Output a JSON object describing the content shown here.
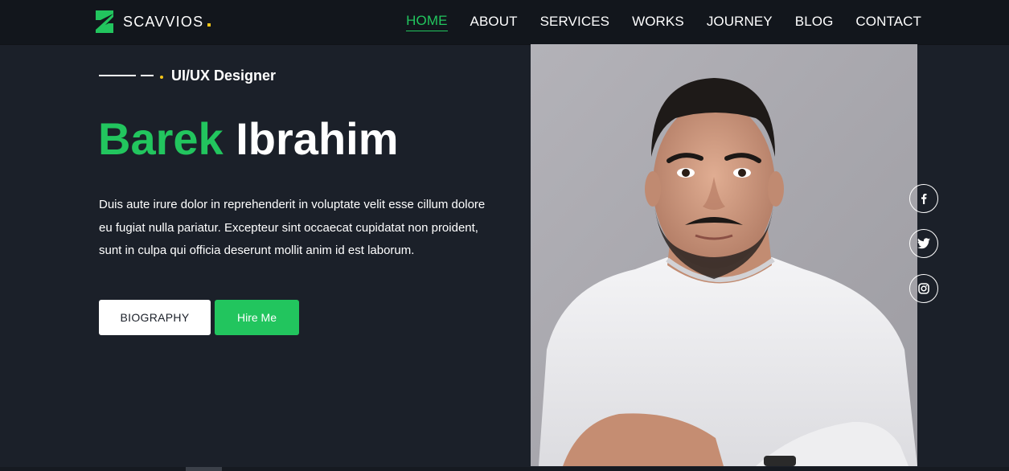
{
  "brand": {
    "name": "SCAVVIOS",
    "accent_color": "#22c55e",
    "dot_color": "#f5c518",
    "logo_icon": "scavvios-logo-mark-icon"
  },
  "nav": {
    "items": [
      {
        "label": "HOME",
        "active": true
      },
      {
        "label": "ABOUT",
        "active": false
      },
      {
        "label": "SERVICES",
        "active": false
      },
      {
        "label": "WORKS",
        "active": false
      },
      {
        "label": "JOURNEY",
        "active": false
      },
      {
        "label": "BLOG",
        "active": false
      },
      {
        "label": "CONTACT",
        "active": false
      }
    ]
  },
  "hero": {
    "role": "UI/UX Designer",
    "first_name": "Barek",
    "last_name": "Ibrahim",
    "description": "Duis aute irure dolor in reprehenderit in voluptate velit esse cillum dolore eu fugiat nulla pariatur. Excepteur sint occaecat cupidatat non proident, sunt in culpa qui officia deserunt mollit anim id est laborum.",
    "buttons": {
      "biography_label": "BIOGRAPHY",
      "hire_label": "Hire Me"
    }
  },
  "social": [
    {
      "icon": "facebook-icon"
    },
    {
      "icon": "twitter-icon"
    },
    {
      "icon": "instagram-icon"
    }
  ],
  "colors": {
    "background": "#1b2029",
    "header": "#12161c",
    "portrait_bg": "#a9a8ae"
  }
}
